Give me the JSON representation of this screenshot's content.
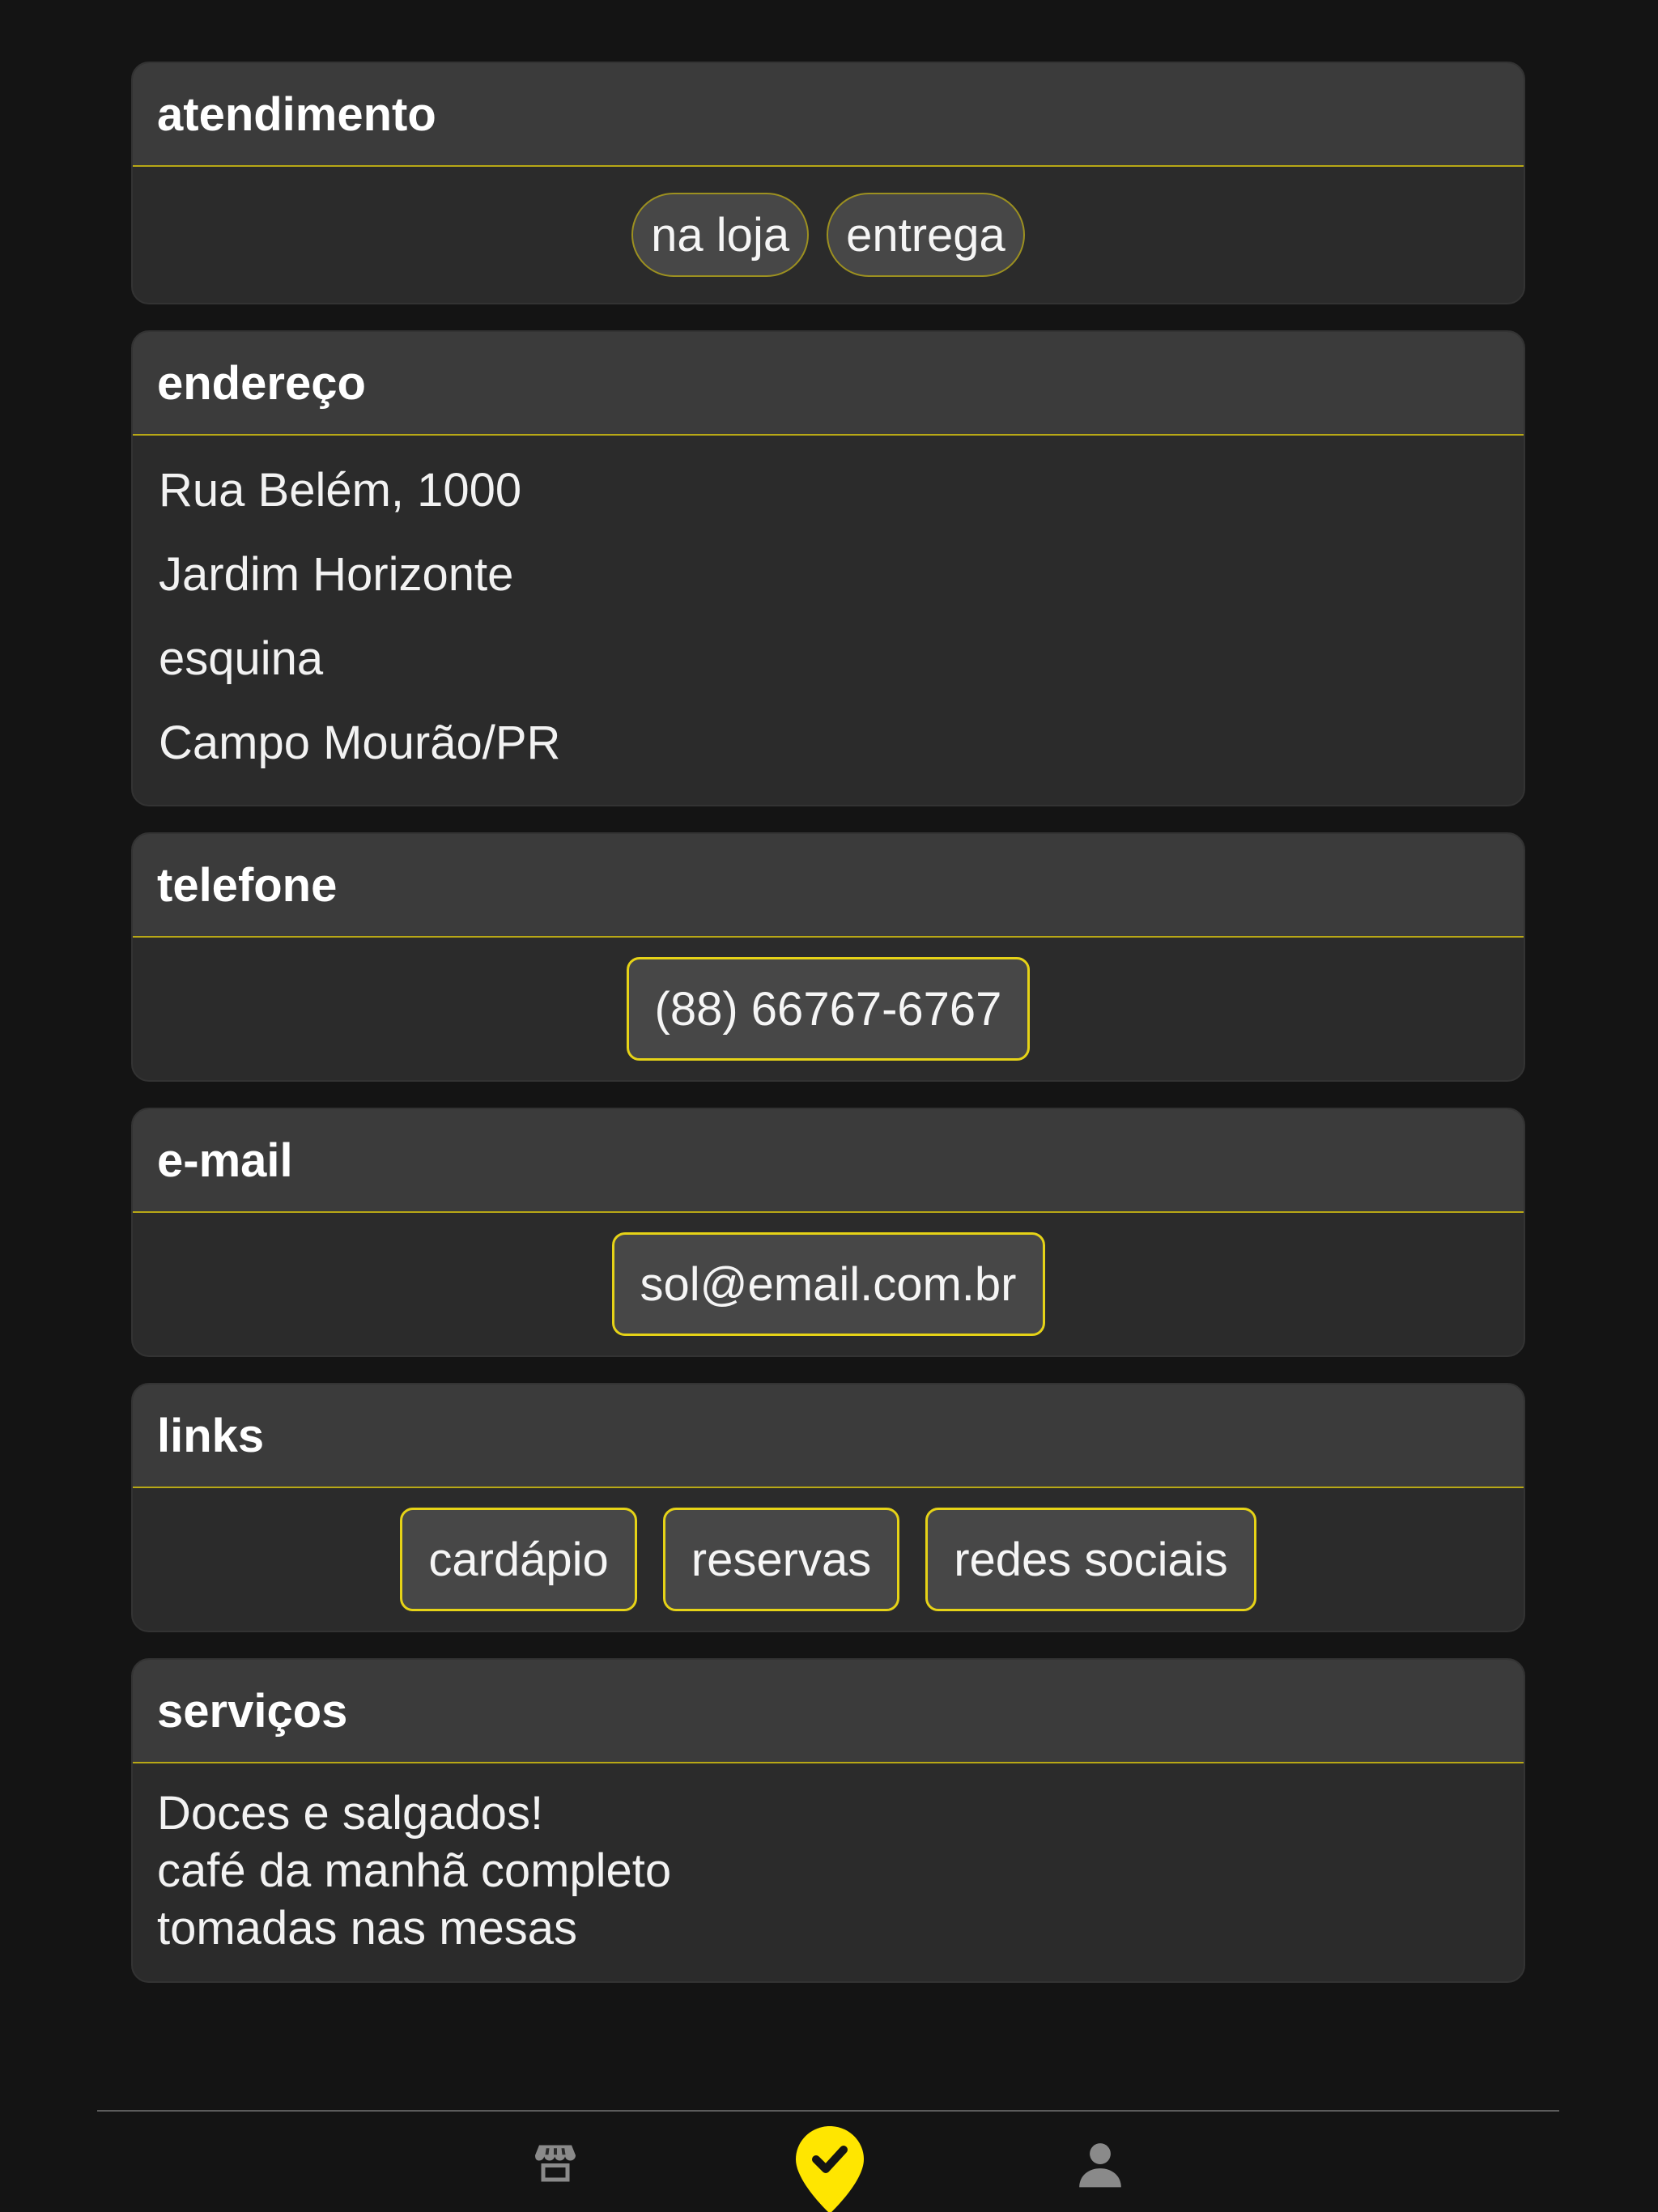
{
  "sections": {
    "atendimento": {
      "title": "atendimento",
      "chips": [
        "na loja",
        "entrega"
      ]
    },
    "endereco": {
      "title": "endereço",
      "lines": [
        "Rua Belém, 1000",
        "Jardim Horizonte",
        "esquina",
        "Campo Mourão/PR"
      ]
    },
    "telefone": {
      "title": "telefone",
      "value": "(88) 66767-6767"
    },
    "email": {
      "title": "e-mail",
      "value": "sol@email.com.br"
    },
    "links": {
      "title": "links",
      "items": [
        "cardápio",
        "reservas",
        "redes sociais"
      ]
    },
    "servicos": {
      "title": "serviços",
      "lines": [
        "Doces e salgados!",
        "café da manhã completo",
        "tomadas nas mesas"
      ]
    }
  },
  "bottom_nav": {
    "items": [
      {
        "icon": "store-icon",
        "active": false
      },
      {
        "icon": "check-pin-icon",
        "active": true
      },
      {
        "icon": "user-icon",
        "active": false
      }
    ]
  },
  "colors": {
    "background": "#141414",
    "card": "#2b2b2b",
    "card_header": "#3b3b3b",
    "accent": "#ffe600",
    "divider": "#b8a816",
    "icon_inactive": "#8a8a8a"
  }
}
